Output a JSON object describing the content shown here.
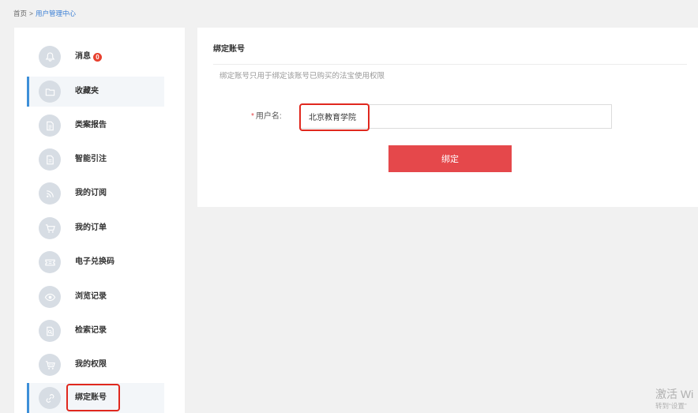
{
  "breadcrumb": {
    "home": "首页",
    "separator": ">",
    "current": "用户管理中心"
  },
  "sidebar": {
    "items": [
      {
        "label": "消息",
        "icon": "bell-icon",
        "badge": "0"
      },
      {
        "label": "收藏夹",
        "icon": "folder-icon"
      },
      {
        "label": "类案报告",
        "icon": "report-document-icon"
      },
      {
        "label": "智能引注",
        "icon": "citation-document-icon"
      },
      {
        "label": "我的订阅",
        "icon": "rss-icon"
      },
      {
        "label": "我的订单",
        "icon": "cart-icon"
      },
      {
        "label": "电子兑换码",
        "icon": "ticket-icon"
      },
      {
        "label": "浏览记录",
        "icon": "eye-icon"
      },
      {
        "label": "检索记录",
        "icon": "search-document-icon"
      },
      {
        "label": "我的权限",
        "icon": "cart-icon"
      },
      {
        "label": "绑定账号",
        "icon": "link-icon"
      }
    ]
  },
  "main": {
    "title": "绑定账号",
    "description": "绑定账号只用于绑定该账号已购买的法宝使用权限",
    "form": {
      "required_mark": "*",
      "username_label": "用户名:",
      "username_value": "北京教育学院",
      "submit_label": "绑定"
    }
  },
  "watermark": {
    "line1": "激活 Wi",
    "line2": "转到“设置”"
  },
  "colors": {
    "accent-blue": "#3d8fd8",
    "link-blue": "#3a7fd5",
    "button-red": "#e5484b",
    "badge-red": "#e8412f",
    "annotation-red": "#e0281e"
  }
}
